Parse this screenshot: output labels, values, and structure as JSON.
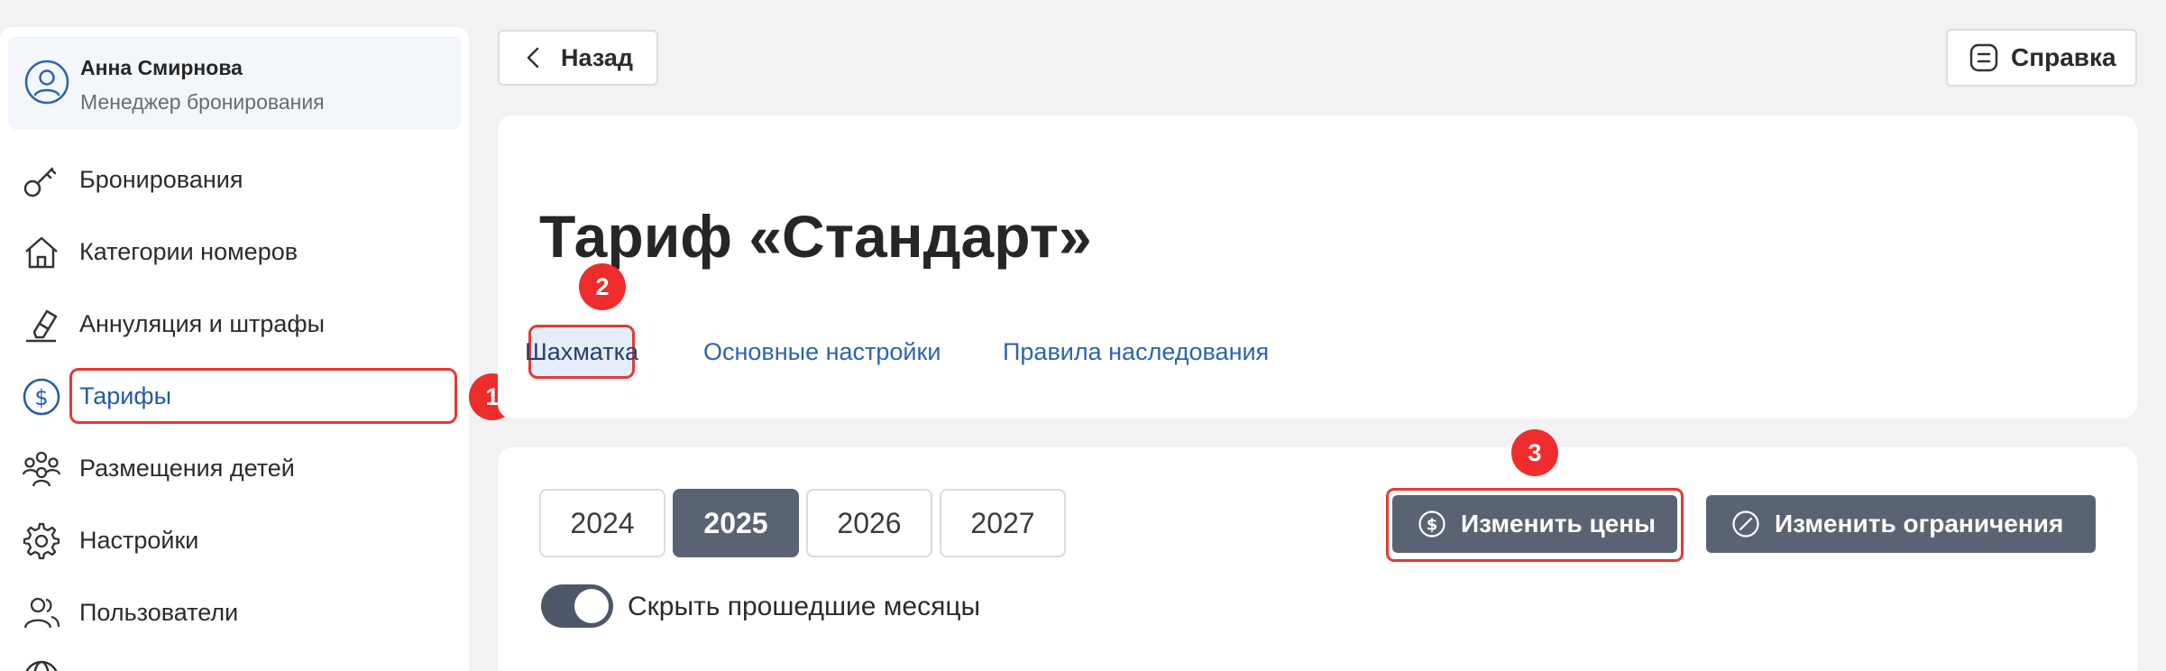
{
  "user": {
    "name": "Анна Смирнова",
    "role": "Менеджер бронирования"
  },
  "nav": {
    "items": [
      {
        "label": "Бронирования",
        "icon": "key-icon"
      },
      {
        "label": "Категории номеров",
        "icon": "home-icon"
      },
      {
        "label": "Аннуляция и штрафы",
        "icon": "eraser-icon"
      },
      {
        "label": "Тарифы",
        "icon": "dollar-circle-icon",
        "active": true
      },
      {
        "label": "Размещения детей",
        "icon": "people-group-icon"
      },
      {
        "label": "Настройки",
        "icon": "gear-icon"
      },
      {
        "label": "Пользователи",
        "icon": "users-icon"
      }
    ]
  },
  "badges": {
    "one": "1",
    "two": "2",
    "three": "3"
  },
  "header": {
    "back_label": "Назад",
    "help_label": "Справка"
  },
  "page": {
    "title": "Тариф «Стандарт»",
    "tabs": [
      {
        "label": "Шахматка",
        "active": true
      },
      {
        "label": "Основные настройки"
      },
      {
        "label": "Правила наследования"
      }
    ]
  },
  "content": {
    "years": [
      {
        "label": "2024"
      },
      {
        "label": "2025",
        "active": true
      },
      {
        "label": "2026"
      },
      {
        "label": "2027"
      }
    ],
    "toggle_label": "Скрыть прошедшие месяцы",
    "toggle_on": true,
    "edit_prices_label": "Изменить цены",
    "edit_restrictions_label": "Изменить ограничения"
  },
  "colors": {
    "accent": "#2459a8",
    "highlight": "#e53935",
    "button_dark": "#5a6373"
  }
}
